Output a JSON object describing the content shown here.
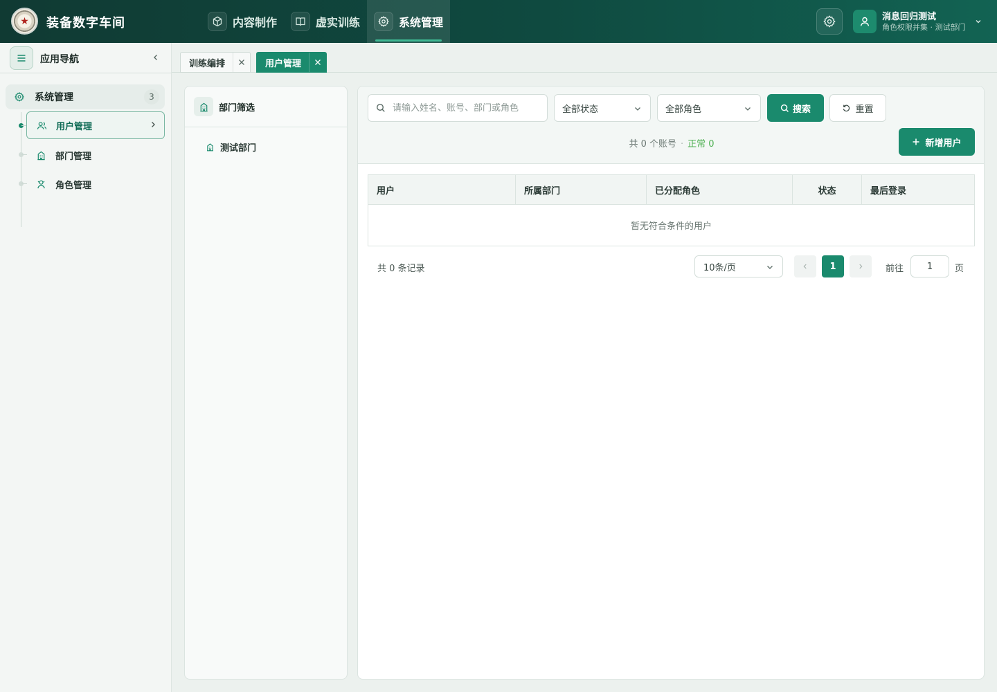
{
  "app": {
    "title": "装备数字车间"
  },
  "nav": {
    "items": [
      {
        "label": "内容制作",
        "icon": "cube-icon"
      },
      {
        "label": "虚实训练",
        "icon": "book-icon"
      },
      {
        "label": "系统管理",
        "icon": "gear-icon",
        "active": true
      }
    ]
  },
  "user": {
    "name": "消息回归测试",
    "subtitle": "角色权限并集 · 测试部门"
  },
  "sidebar": {
    "title": "应用导航",
    "group": {
      "label": "系统管理",
      "count": "3"
    },
    "items": [
      {
        "label": "用户管理",
        "active": true
      },
      {
        "label": "部门管理"
      },
      {
        "label": "角色管理"
      }
    ]
  },
  "tabs": [
    {
      "label": "训练编排"
    },
    {
      "label": "用户管理",
      "active": true
    }
  ],
  "dept": {
    "title": "部门筛选",
    "items": [
      {
        "label": "测试部门"
      }
    ]
  },
  "toolbar": {
    "search_placeholder": "请输入姓名、账号、部门或角色",
    "status_select": "全部状态",
    "role_select": "全部角色",
    "search_button": "搜索",
    "reset_button": "重置",
    "add_button": "新增用户",
    "summary_total": "共 0 个账号",
    "summary_sep": "·",
    "summary_ok": "正常 0"
  },
  "table": {
    "columns": [
      "用户",
      "所属部门",
      "已分配角色",
      "状态",
      "最后登录"
    ],
    "empty_text": "暂无符合条件的用户"
  },
  "pagination": {
    "total": "共 0 条记录",
    "page_size": "10条/页",
    "current": "1",
    "goto_label": "前往",
    "goto_value": "1",
    "page_unit": "页"
  },
  "colors": {
    "primary": "#1a8a6d",
    "topbar": "#0f4a40",
    "success": "#4caf50"
  }
}
